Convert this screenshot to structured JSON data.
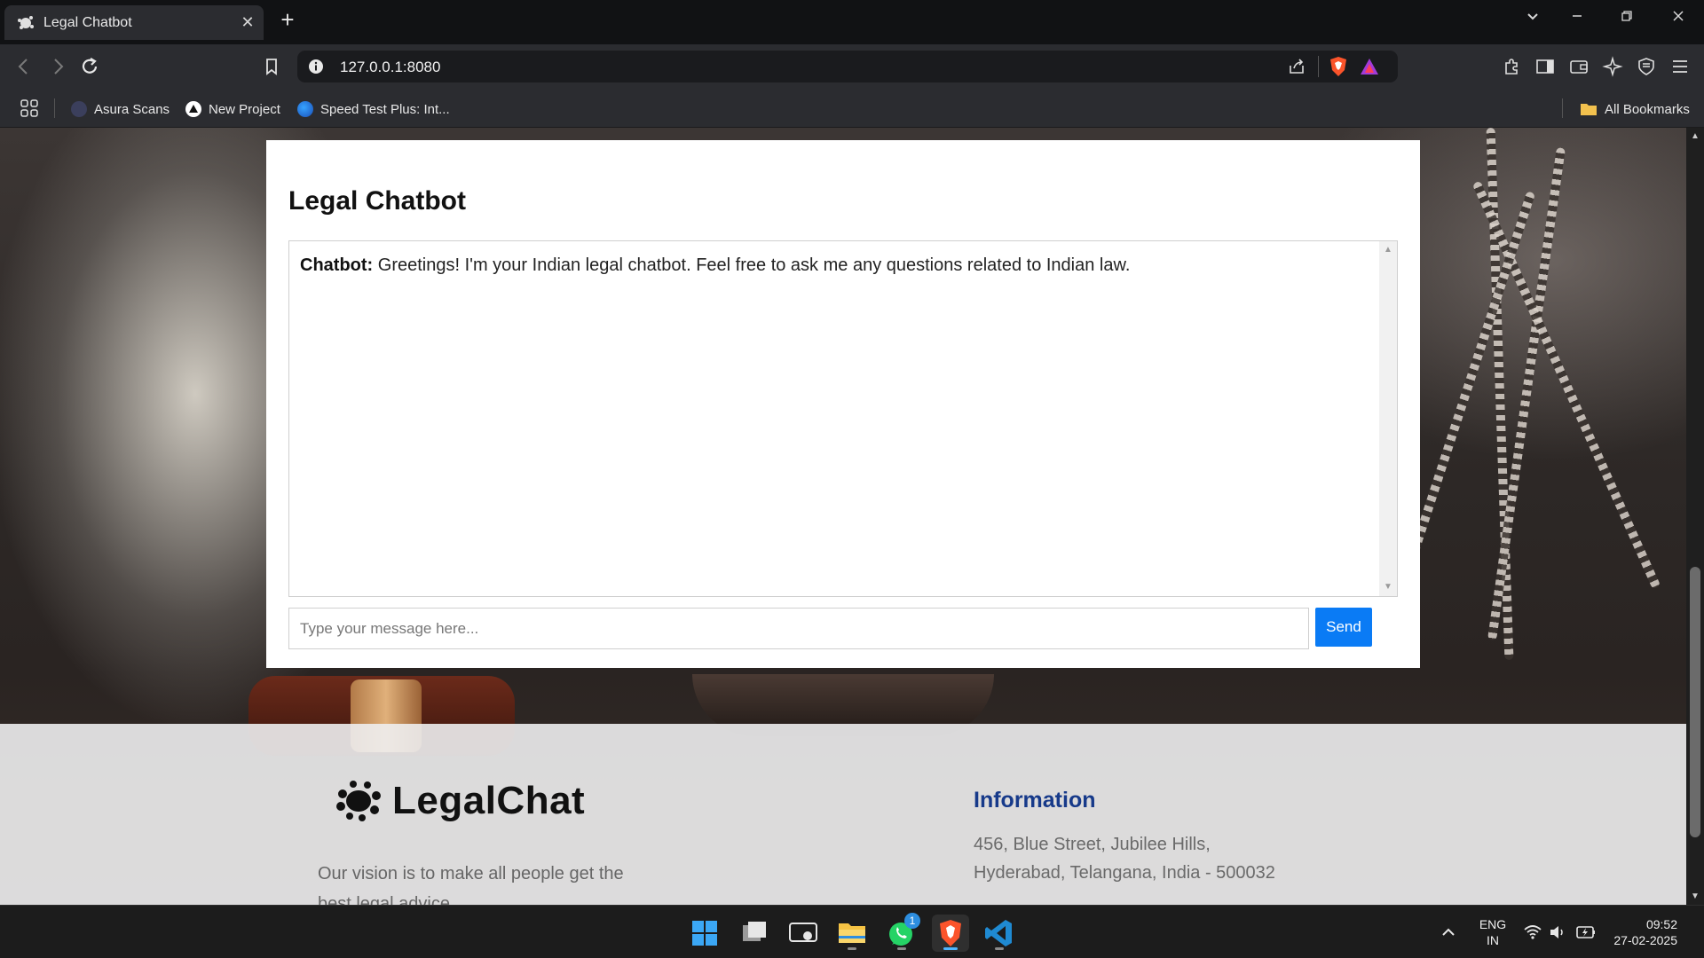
{
  "browser": {
    "tab_title": "Legal Chatbot",
    "url": "127.0.0.1:8080",
    "bookmarks": [
      {
        "label": "Asura Scans",
        "icon": "asura-icon"
      },
      {
        "label": "New Project",
        "icon": "triangle-icon"
      },
      {
        "label": "Speed Test Plus: Int...",
        "icon": "speedtest-icon"
      }
    ],
    "all_bookmarks": "All Bookmarks"
  },
  "chat": {
    "title": "Legal Chatbot",
    "messages": [
      {
        "sender": "Chatbot:",
        "text": " Greetings! I'm your Indian legal chatbot. Feel free to ask me any questions related to Indian law."
      }
    ],
    "input_placeholder": "Type your message here...",
    "send_label": "Send"
  },
  "footer": {
    "brand": "LegalChat",
    "vision": "Our vision is to make all people get the best legal advice",
    "info_heading": "Information",
    "address_line1": "456, Blue Street, Jubilee Hills,",
    "address_line2": "Hyderabad, Telangana, India - 500032"
  },
  "taskbar": {
    "whatsapp_badge": "1",
    "lang_line1": "ENG",
    "lang_line2": "IN",
    "time": "09:52",
    "date": "27-02-2025"
  },
  "colors": {
    "send_button": "#0a7bf5",
    "info_heading": "#173a8a",
    "brave_orange": "#fb542b"
  }
}
